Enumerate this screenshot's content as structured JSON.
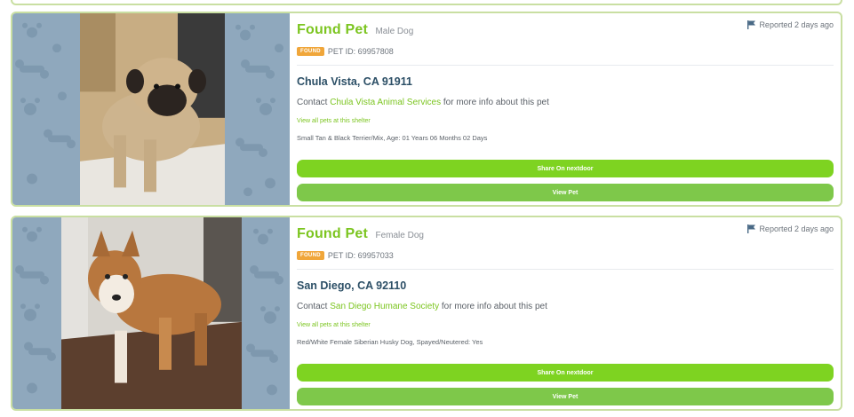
{
  "pets": [
    {
      "title": "Found Pet",
      "gender": "Male Dog",
      "reported": "Reported 2 days ago",
      "badge": "FOUND",
      "pet_id": "PET ID: 69957808",
      "location": "Chula Vista, CA 91911",
      "contact_prefix": "Contact",
      "shelter": "Chula Vista Animal Services",
      "contact_suffix": "for more info about this pet",
      "view_all": "View all pets at this shelter",
      "description": "Small Tan & Black Terrier/Mix, Age: 01 Years 06 Months 02 Days",
      "share_label": "Share On nextdoor",
      "view_label": "View Pet"
    },
    {
      "title": "Found Pet",
      "gender": "Female Dog",
      "reported": "Reported 2 days ago",
      "badge": "FOUND",
      "pet_id": "PET ID: 69957033",
      "location": "San Diego, CA 92110",
      "contact_prefix": "Contact",
      "shelter": "San Diego Humane Society",
      "contact_suffix": "for more info about this pet",
      "view_all": "View all pets at this shelter",
      "description": "Red/White Female Siberian Husky Dog, Spayed/Neutered: Yes",
      "share_label": "Share On nextdoor",
      "view_label": "View Pet"
    }
  ],
  "colors": {
    "accent_green": "#7cc520",
    "button_green": "#7ed321",
    "badge_orange": "#f0a63a",
    "location_blue": "#2c4f66",
    "pattern_blue": "#8fa8bd",
    "card_border": "#c9dfa2"
  },
  "icons": [
    "flag-icon",
    "dog-photo",
    "paw-pattern"
  ]
}
